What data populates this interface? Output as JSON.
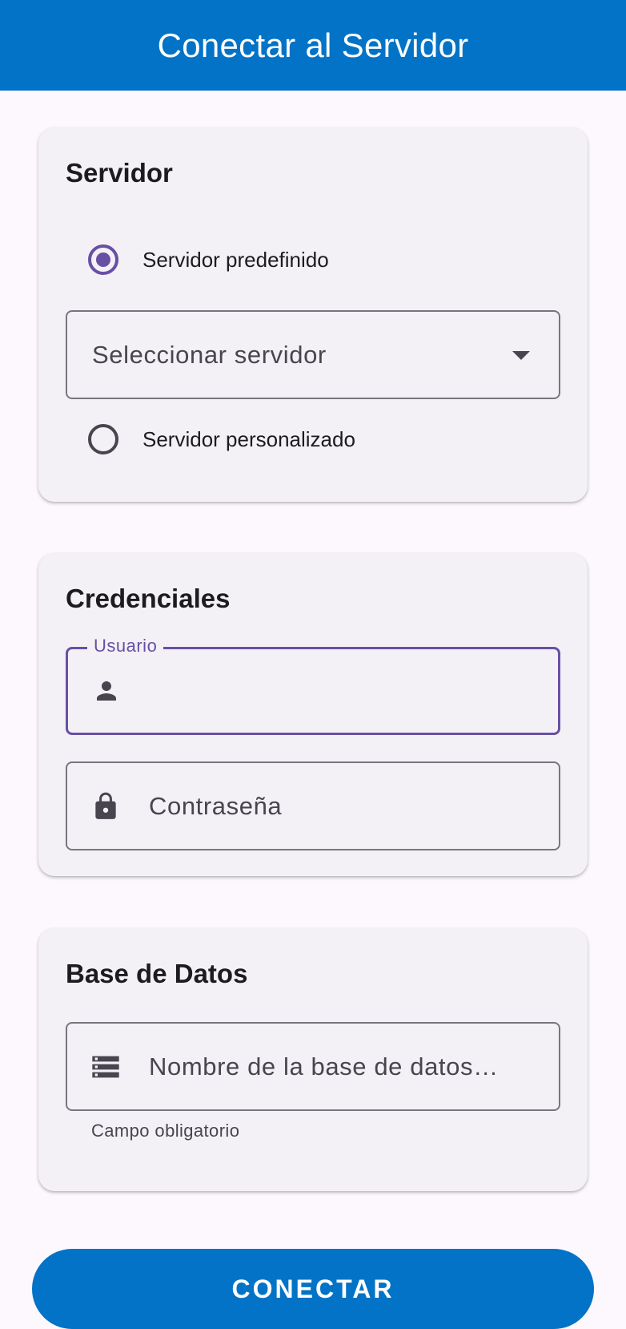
{
  "app_bar": {
    "title": "Conectar al Servidor"
  },
  "server_card": {
    "title": "Servidor",
    "predefined_label": "Servidor predefinido",
    "predefined_selected": true,
    "select_placeholder": "Seleccionar servidor",
    "custom_label": "Servidor personalizado",
    "custom_selected": false
  },
  "credentials_card": {
    "title": "Credenciales",
    "username_label": "Usuario",
    "username_value": "",
    "password_placeholder": "Contraseña"
  },
  "database_card": {
    "title": "Base de Datos",
    "db_placeholder": "Nombre de la base de datos…",
    "helper_text": "Campo obligatorio"
  },
  "connect_button": {
    "label": "CONECTAR"
  },
  "colors": {
    "primary_blue": "#0273c6",
    "accent_purple": "#6750a4",
    "card_background": "#f4f1f6",
    "page_background": "#fcf8fd"
  },
  "icons": {
    "username": "person-icon",
    "password": "lock-icon",
    "database": "storage-icon",
    "dropdown": "arrow-drop-down-icon"
  }
}
